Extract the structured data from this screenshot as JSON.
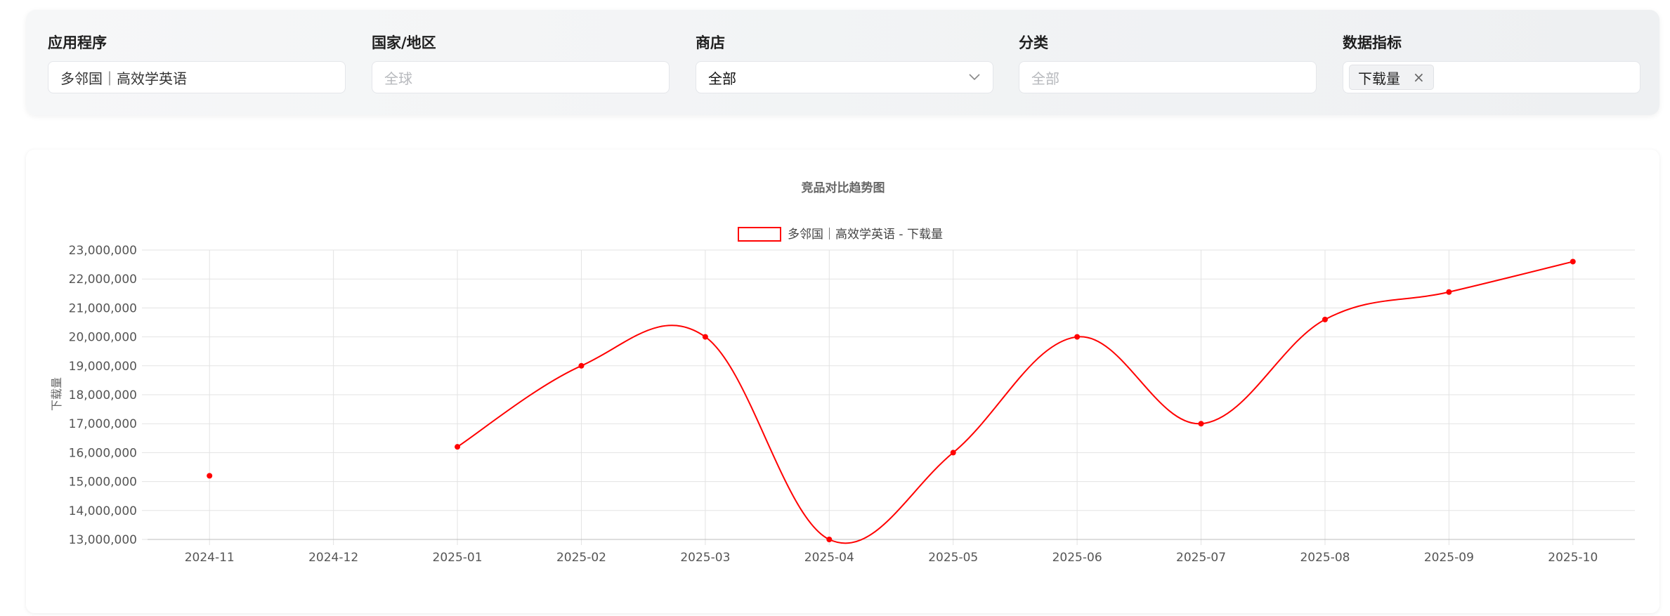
{
  "filters": {
    "app": {
      "label": "应用程序",
      "value": "多邻国｜高效学英语"
    },
    "region": {
      "label": "国家/地区",
      "placeholder": "全球"
    },
    "store": {
      "label": "商店",
      "value": "全部"
    },
    "category": {
      "label": "分类",
      "placeholder": "全部"
    },
    "metric": {
      "label": "数据指标",
      "tag": "下载量",
      "tag_close": "×"
    }
  },
  "colors": {
    "series": "#ff0000",
    "grid": "#e3e3e3",
    "axis_text": "#555555"
  },
  "chart_data": {
    "type": "line",
    "title": "竞品对比趋势图",
    "ylabel": "下载量",
    "xlabel": "",
    "categories": [
      "2024-11",
      "2024-12",
      "2025-01",
      "2025-02",
      "2025-03",
      "2025-04",
      "2025-05",
      "2025-06",
      "2025-07",
      "2025-08",
      "2025-09",
      "2025-10"
    ],
    "yticks": [
      "23,000,000",
      "22,000,000",
      "21,000,000",
      "20,000,000",
      "19,000,000",
      "18,000,000",
      "17,000,000",
      "16,000,000",
      "15,000,000",
      "14,000,000",
      "13,000,000"
    ],
    "ylim": [
      13000000,
      23000000
    ],
    "grid": true,
    "legend_position": "top-center",
    "series": [
      {
        "name": "多邻国｜高效学英语 - 下载量",
        "values": [
          15200000,
          null,
          16200000,
          19000000,
          20000000,
          13000000,
          16000000,
          20000000,
          17000000,
          20600000,
          21550000,
          22600000
        ]
      }
    ]
  }
}
